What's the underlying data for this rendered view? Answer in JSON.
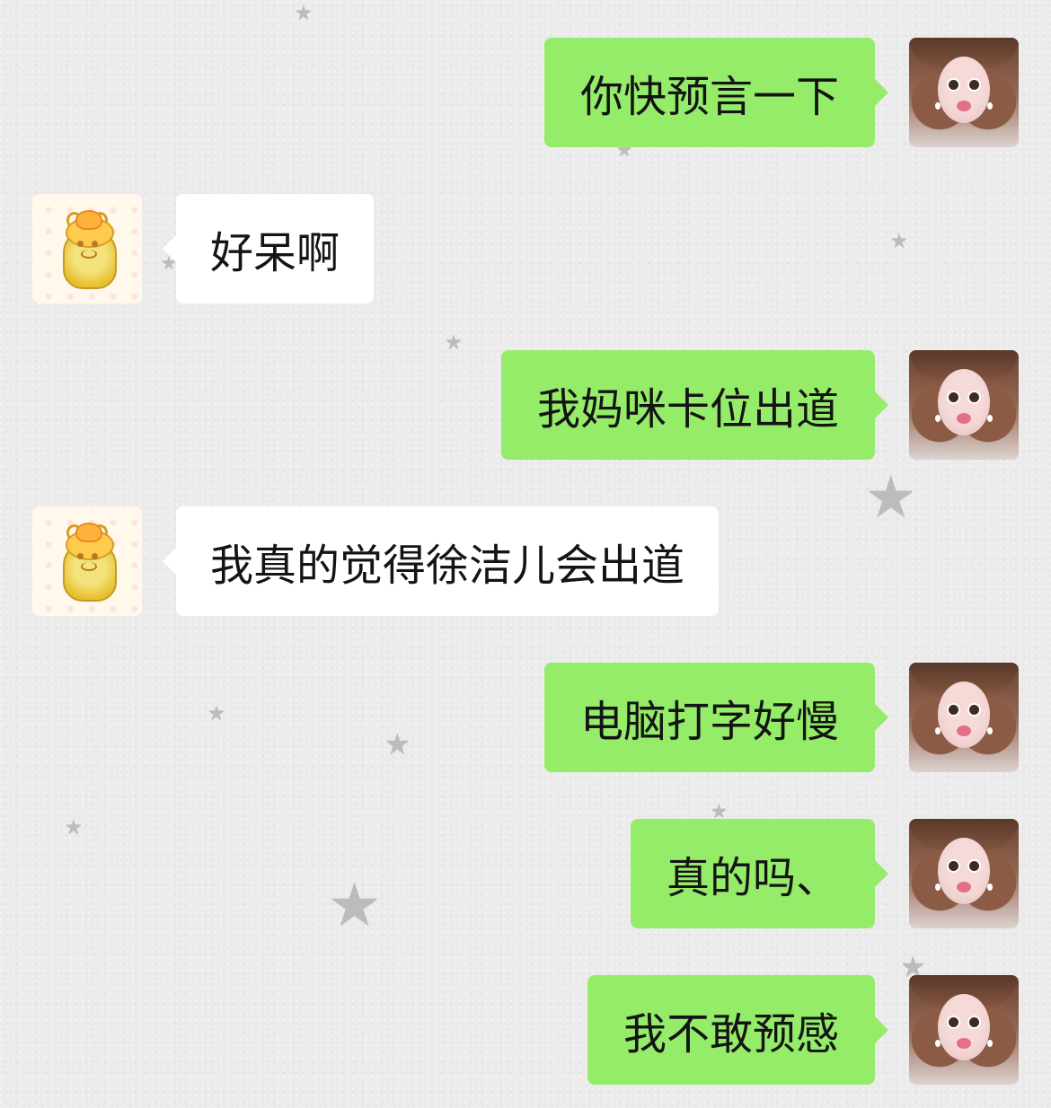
{
  "icons": {
    "decoration": "star-icon",
    "sender": "portrait-avatar-icon",
    "receiver": "bear-avatar-icon"
  },
  "colors": {
    "sent_bubble": "#95ec69",
    "received_bubble": "#ffffff",
    "background": "#ebebeb"
  },
  "messages": [
    {
      "side": "sent",
      "text": "你快预言一下"
    },
    {
      "side": "received",
      "text": "好呆啊"
    },
    {
      "side": "sent",
      "text": "我妈咪卡位出道"
    },
    {
      "side": "received",
      "text": "我真的觉得徐洁儿会出道"
    },
    {
      "side": "sent",
      "text": "电脑打字好慢"
    },
    {
      "side": "sent",
      "text": "真的吗、"
    },
    {
      "side": "sent",
      "text": "我不敢预感"
    }
  ],
  "stars": {
    "glyph": "★"
  }
}
